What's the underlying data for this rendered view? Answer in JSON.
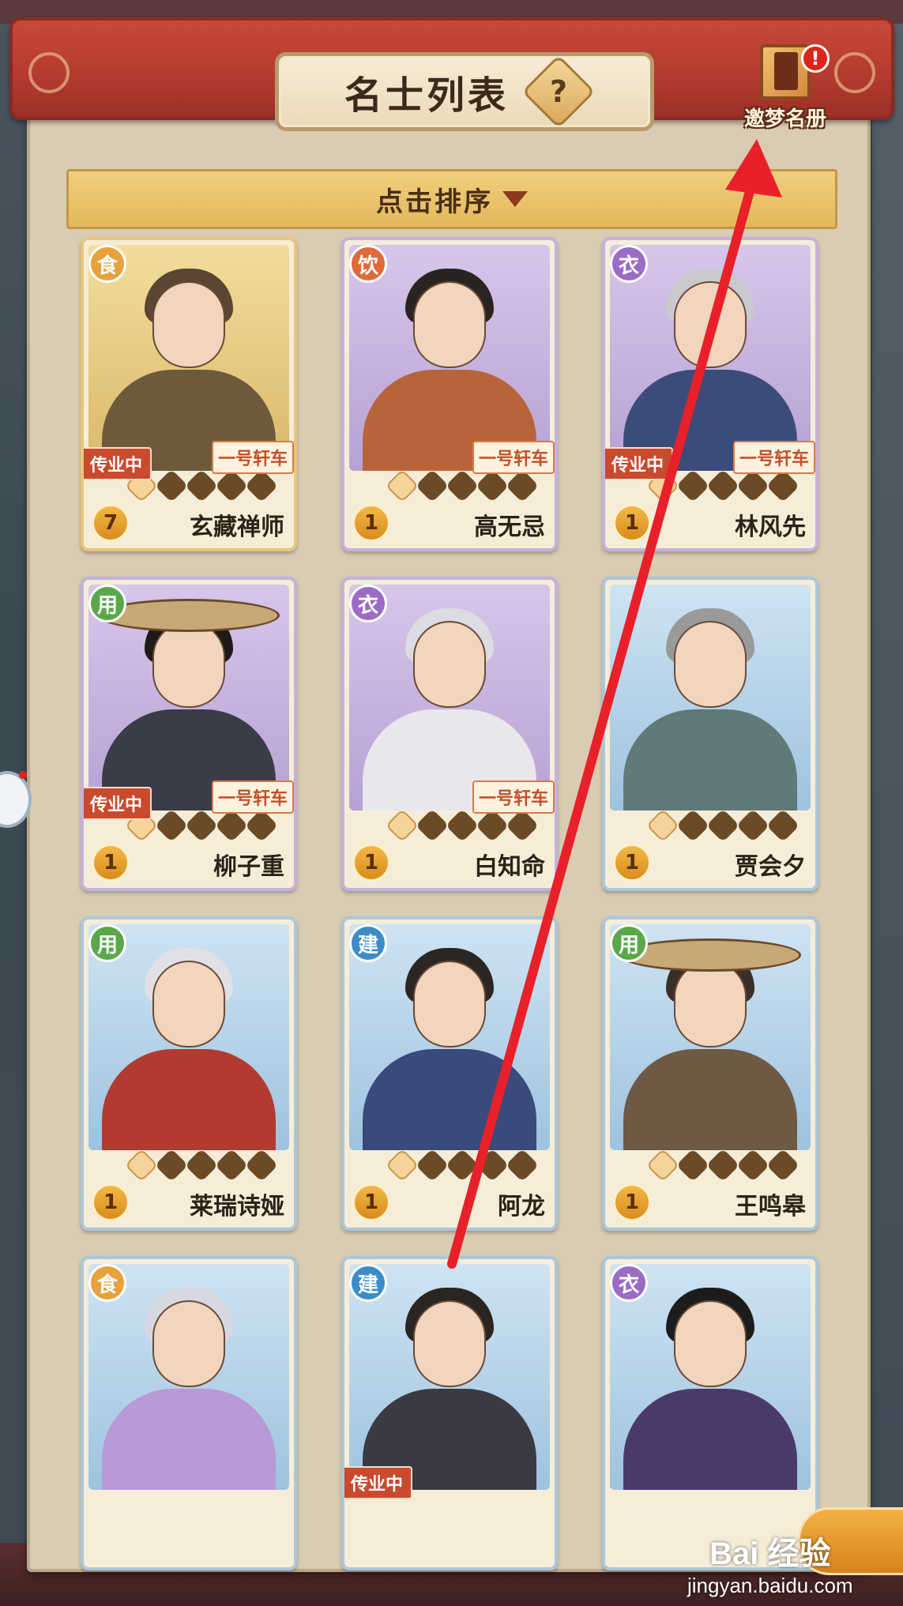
{
  "header": {
    "title": "名士列表",
    "help_label": "?",
    "roster_label": "邀梦名册",
    "roster_badge": "!"
  },
  "sort": {
    "label": "点击排序"
  },
  "cards": [
    {
      "name": "玄藏禅师",
      "type": "食",
      "level": "7",
      "teaching": "传业中",
      "cart": "一号轩车",
      "stars_on": 1,
      "theme": "gold"
    },
    {
      "name": "高无忌",
      "type": "饮",
      "level": "1",
      "teaching": "",
      "cart": "一号轩车",
      "stars_on": 1,
      "theme": "purple"
    },
    {
      "name": "林风先",
      "type": "衣",
      "level": "1",
      "teaching": "传业中",
      "cart": "一号轩车",
      "stars_on": 1,
      "theme": "purple"
    },
    {
      "name": "柳子重",
      "type": "用",
      "level": "1",
      "teaching": "传业中",
      "cart": "一号轩车",
      "stars_on": 1,
      "theme": "purple"
    },
    {
      "name": "白知命",
      "type": "衣",
      "level": "1",
      "teaching": "",
      "cart": "一号轩车",
      "stars_on": 1,
      "theme": "purple"
    },
    {
      "name": "贾会夕",
      "type": "",
      "level": "1",
      "teaching": "",
      "cart": "",
      "stars_on": 1,
      "theme": "blue"
    },
    {
      "name": "莱瑞诗娅",
      "type": "用",
      "level": "1",
      "teaching": "",
      "cart": "",
      "stars_on": 1,
      "theme": "blue"
    },
    {
      "name": "阿龙",
      "type": "建",
      "level": "1",
      "teaching": "",
      "cart": "",
      "stars_on": 1,
      "theme": "blue"
    },
    {
      "name": "王鸣皋",
      "type": "用",
      "level": "1",
      "teaching": "",
      "cart": "",
      "stars_on": 1,
      "theme": "blue"
    },
    {
      "name": "",
      "type": "食",
      "level": "",
      "teaching": "",
      "cart": "",
      "stars_on": 0,
      "theme": "blue"
    },
    {
      "name": "",
      "type": "建",
      "level": "",
      "teaching": "传业中",
      "cart": "",
      "stars_on": 0,
      "theme": "blue"
    },
    {
      "name": "",
      "type": "衣",
      "level": "",
      "teaching": "",
      "cart": "",
      "stars_on": 0,
      "theme": "blue"
    }
  ],
  "watermark": {
    "top": "Bai 经验",
    "bottom": "jingyan.baidu.com"
  },
  "colors": {
    "header_red": "#b23a2e",
    "panel_bg": "#efe5d2",
    "sort_bar": "#e3b85c",
    "annotation_arrow": "#e8202a"
  }
}
